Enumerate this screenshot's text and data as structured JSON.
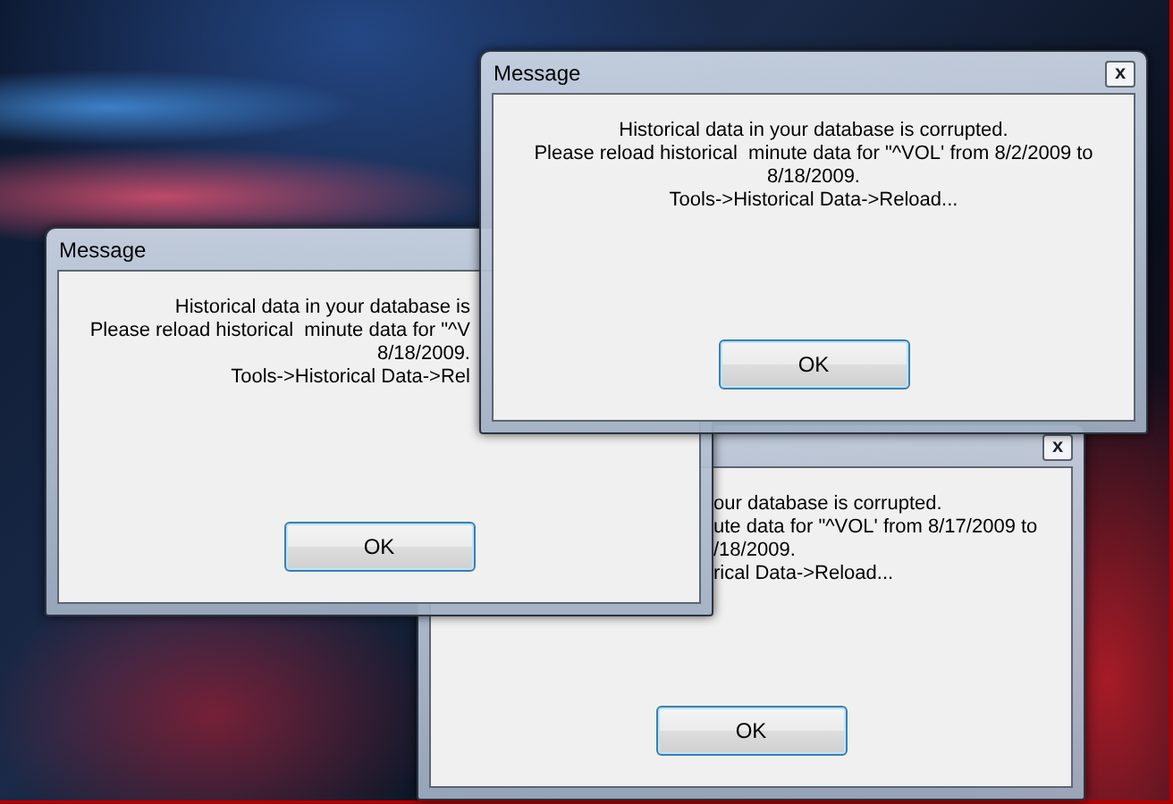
{
  "windows": [
    {
      "title": "Message",
      "close_button": "x",
      "message_lines": [
        "Historical data in your database is corrupted.",
        "Please reload historical  minute data for \"^VOL' from 8/2/2009 to",
        "8/18/2009.",
        "Tools->Historical Data->Reload..."
      ],
      "button": "OK"
    },
    {
      "title": "Message",
      "message_lines": [
        "Historical data in your database is",
        "Please reload historical  minute data for \"^V",
        "8/18/2009.",
        "Tools->Historical Data->Rel"
      ],
      "button": "OK"
    },
    {
      "close_button": "x",
      "message_lines": [
        "our database is corrupted.",
        "ute data for \"^VOL' from 8/17/2009 to",
        "/18/2009.",
        "rical Data->Reload..."
      ],
      "button": "OK"
    }
  ]
}
